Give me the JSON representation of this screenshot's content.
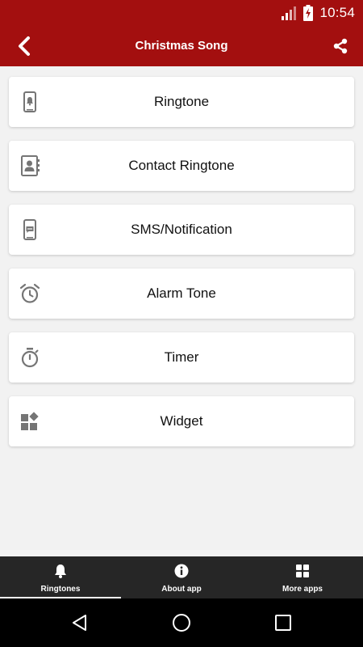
{
  "status_bar": {
    "time": "10:54",
    "icons": [
      "signal-icon",
      "battery-charging-icon"
    ]
  },
  "app_bar": {
    "title": "Christmas Song",
    "back_icon": "chevron-left-icon",
    "share_icon": "share-icon"
  },
  "menu": {
    "items": [
      {
        "label": "Ringtone",
        "icon": "phone-bell-icon"
      },
      {
        "label": "Contact Ringtone",
        "icon": "contacts-icon"
      },
      {
        "label": "SMS/Notification",
        "icon": "phone-message-icon"
      },
      {
        "label": "Alarm Tone",
        "icon": "alarm-clock-icon"
      },
      {
        "label": "Timer",
        "icon": "stopwatch-icon"
      },
      {
        "label": "Widget",
        "icon": "widget-icon"
      }
    ]
  },
  "bottom_nav": {
    "items": [
      {
        "label": "Ringtones",
        "icon": "bell-icon",
        "active": true
      },
      {
        "label": "About app",
        "icon": "info-icon",
        "active": false
      },
      {
        "label": "More apps",
        "icon": "grid-icon",
        "active": false
      }
    ]
  },
  "system_nav": {
    "buttons": [
      "back-triangle-icon",
      "home-circle-icon",
      "recents-square-icon"
    ]
  },
  "colors": {
    "primary": "#a30f0f",
    "background": "#f2f2f2",
    "card": "#ffffff",
    "icon_gray": "#757575",
    "bottom_nav": "#262626"
  }
}
